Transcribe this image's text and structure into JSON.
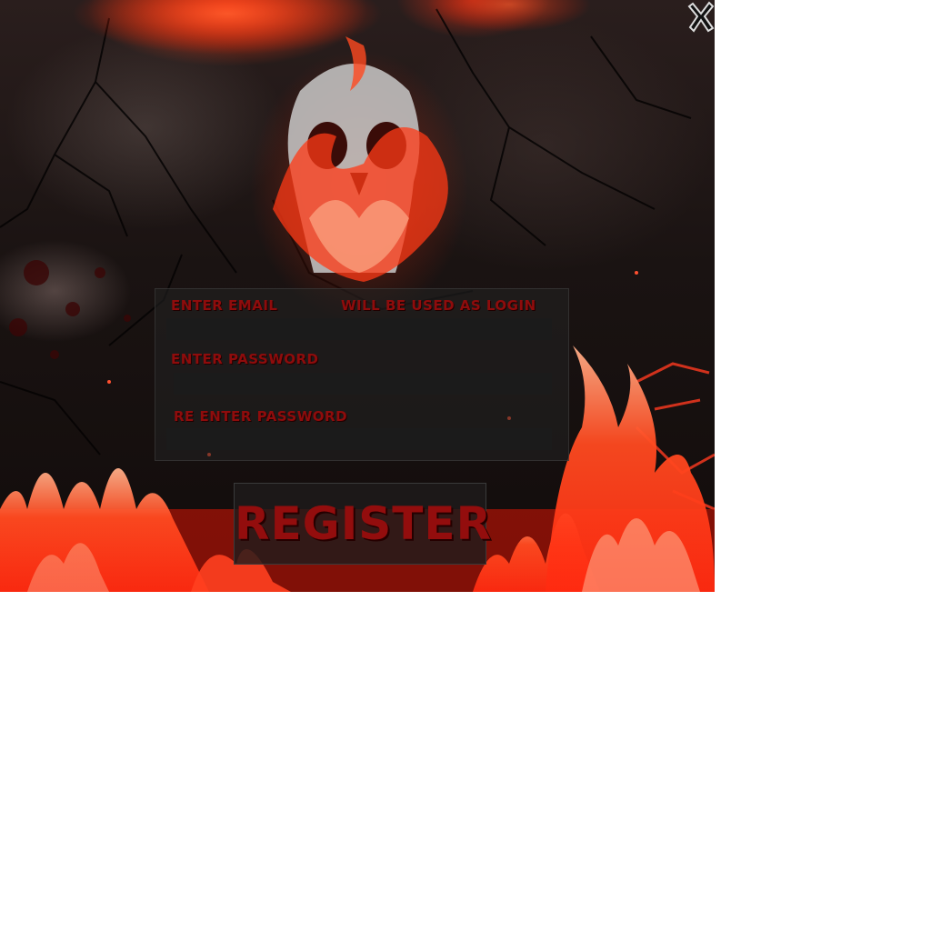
{
  "form": {
    "email_label": "ENTER EMAIL",
    "email_hint": "WILL BE USED AS LOGIN",
    "email_value": "",
    "password_label": "ENTER PASSWORD",
    "password_value": "",
    "repassword_label": "RE ENTER PASSWORD",
    "repassword_value": "",
    "register_label": "REGISTER"
  },
  "window": {
    "close_label": "X"
  },
  "icons": {
    "close": "close-icon",
    "skull": "flaming-skull-icon"
  },
  "colors": {
    "label_red": "#8e0c0c",
    "fire_red": "#ff3c1e",
    "input_bg": "#1b1b1b",
    "panel_bg": "#232323"
  }
}
